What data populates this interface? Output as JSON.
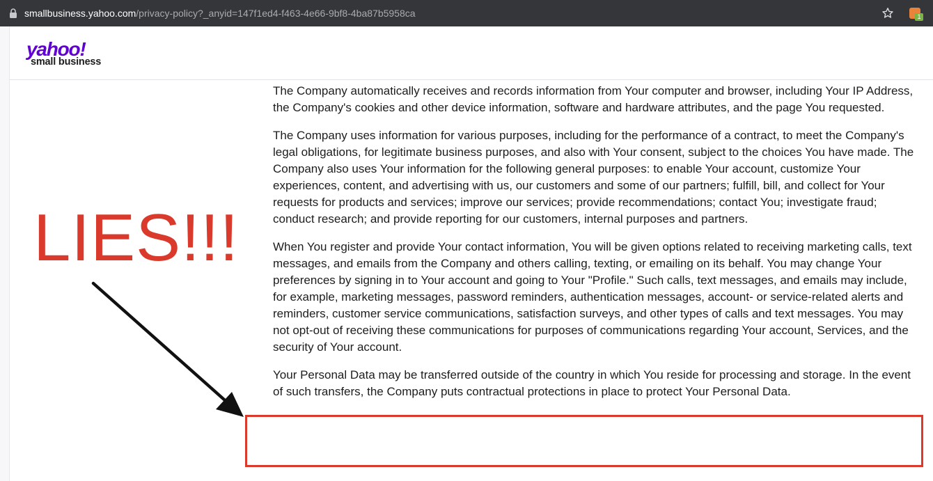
{
  "browser": {
    "url_host": "smallbusiness.yahoo.com",
    "url_path": "/privacy-policy?_anyid=147f1ed4-f463-4e66-9bf8-4ba87b5958ca",
    "extension_badge": "1"
  },
  "header": {
    "logo_brand": "yahoo!",
    "logo_sub": "small business"
  },
  "annotation": {
    "text": "LIES!!!",
    "color": "#d93a2c"
  },
  "content": {
    "paragraphs": [
      "The Company automatically receives and records information from Your computer and browser, including Your IP Address, the Company's cookies and other device information, software and hardware attributes, and the page You requested.",
      "The Company uses information for various purposes, including for the performance of a contract, to meet the Company's legal obligations, for legitimate business purposes, and also with Your consent, subject to the choices You have made. The Company also uses Your information for the following general purposes: to enable Your account, customize Your experiences, content, and advertising with us, our customers and some of our partners; fulfill, bill, and collect for Your requests for products and services; improve our services; provide recommendations; contact You; investigate fraud; conduct research; and provide reporting for our customers, internal purposes and partners.",
      "When You register and provide Your contact information, You will be given options related to receiving marketing calls, text messages, and emails from the Company and others calling, texting, or emailing on its behalf. You may change Your preferences by signing in to Your account and going to Your \"Profile.\" Such calls, text messages, and emails may include, for example, marketing messages, password reminders, authentication messages, account- or service-related alerts and reminders, customer service communications, satisfaction surveys, and other types of calls and text messages. You may not opt-out of receiving these communications for purposes of communications regarding Your account, Services, and the security of Your account.",
      "Your Personal Data may be transferred outside of the country in which You reside for processing and storage. In the event of such transfers, the Company puts contractual protections in place to protect Your Personal Data."
    ]
  },
  "colors": {
    "brand_purple": "#6001d2",
    "toolbar_bg": "#35363a",
    "highlight_red": "#d93a2c"
  }
}
